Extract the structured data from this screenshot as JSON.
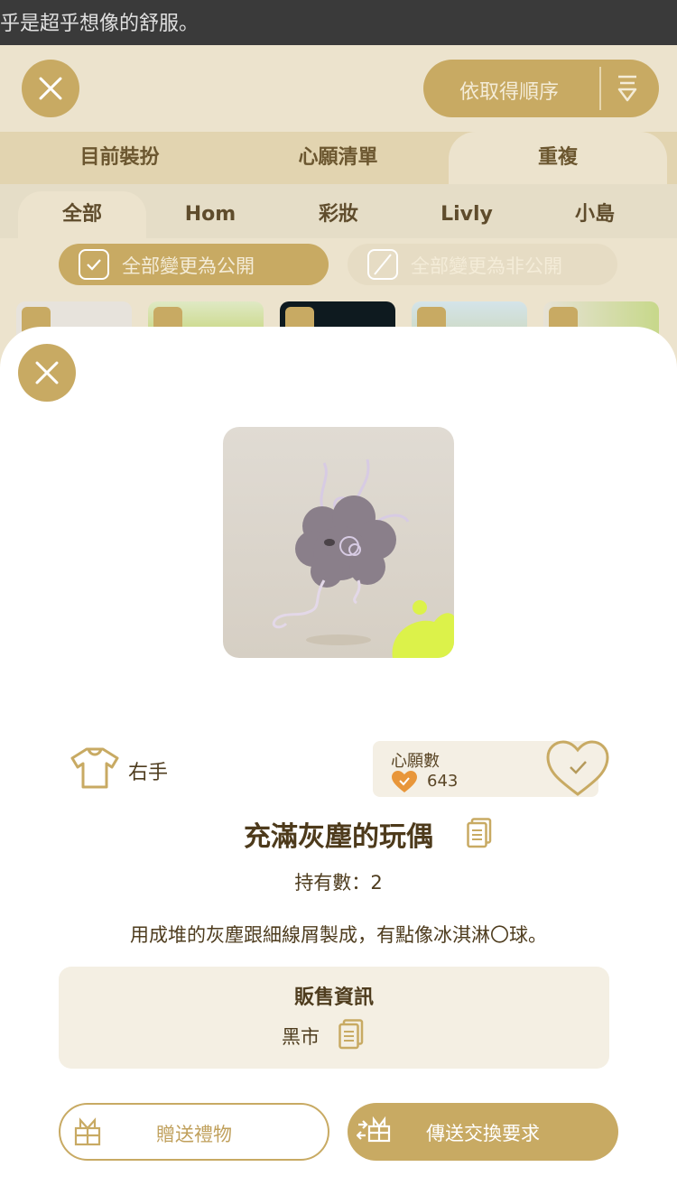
{
  "status_bar": {
    "text": "乎是超乎想像的舒服。"
  },
  "header": {
    "sort_label": "依取得順序"
  },
  "tabs": [
    {
      "label": "目前裝扮"
    },
    {
      "label": "心願清單"
    },
    {
      "label": "重複",
      "active": true
    }
  ],
  "subtabs": [
    {
      "label": "全部",
      "active": true
    },
    {
      "label": "Hom"
    },
    {
      "label": "彩妝"
    },
    {
      "label": "Livly"
    },
    {
      "label": "小島"
    }
  ],
  "visibility": {
    "make_public": "全部變更為公開",
    "make_private": "全部變更為非公開"
  },
  "item": {
    "category": "右手",
    "name": "充滿灰塵的玩偶",
    "owned_label": "持有數：",
    "owned_count": "2",
    "description": "用成堆的灰塵跟細線屑製成，有點像冰淇淋〇球。"
  },
  "wishlist": {
    "title": "心願數",
    "count": "643"
  },
  "sale": {
    "title": "販售資訊",
    "value": "黑市"
  },
  "actions": {
    "gift": "贈送禮物",
    "trade": "傳送交換要求"
  },
  "colors": {
    "accent": "#c8aa63",
    "text": "#4e3c1e",
    "highlight": "#dcf24a"
  }
}
